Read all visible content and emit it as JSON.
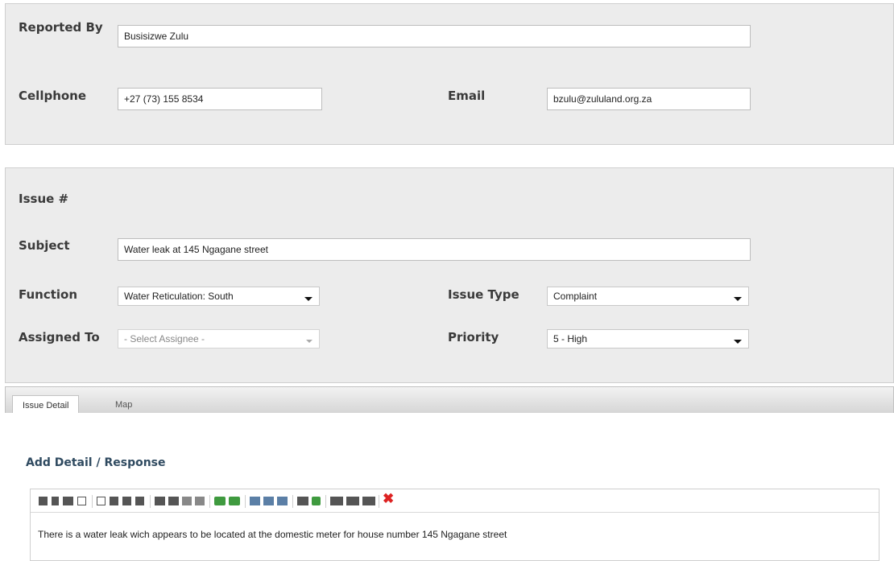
{
  "reporter": {
    "reported_by_label": "Reported By",
    "reported_by_value": "Busisizwe Zulu",
    "cellphone_label": "Cellphone",
    "cellphone_value": "+27 (73) 155 8534",
    "email_label": "Email",
    "email_value": "bzulu@zululand.org.za"
  },
  "issue": {
    "issue_number_label": "Issue #",
    "subject_label": "Subject",
    "subject_value": "Water leak at 145 Ngagane street",
    "function_label": "Function",
    "function_value": "Water Reticulation: South",
    "issue_type_label": "Issue Type",
    "issue_type_value": "Complaint",
    "assigned_to_label": "Assigned To",
    "assigned_to_value": "- Select Assignee -",
    "priority_label": "Priority",
    "priority_value": "5 - High"
  },
  "tabs": [
    {
      "label": "Issue Detail",
      "active": true
    },
    {
      "label": "Map",
      "active": false
    }
  ],
  "detail": {
    "heading": "Add Detail / Response",
    "text": "There is a water leak wich appears to be located at the domestic meter for house number 145 Ngagane street"
  },
  "toolbar": {
    "icons": [
      "image-icon",
      "music-icon",
      "link-icon",
      "document-icon",
      "align-left-icon",
      "align-center-icon",
      "align-right-icon",
      "align-justify-icon",
      "indent-icon",
      "outdent-icon",
      "subscript-icon",
      "superscript-icon",
      "undo-icon",
      "redo-icon",
      "bulleted-list-icon",
      "numbered-list-icon",
      "horizontal-rule-icon",
      "link-insert-icon",
      "image-insert-icon",
      "table-icon",
      "table-row-icon",
      "table-column-icon",
      "remove-format-icon"
    ]
  }
}
